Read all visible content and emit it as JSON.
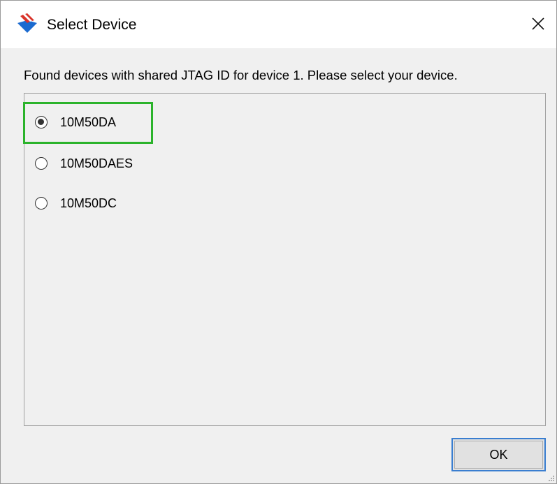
{
  "window": {
    "title": "Select Device",
    "icon": "intel-quartus-logo-icon"
  },
  "dialog": {
    "message": "Found devices with shared JTAG ID for device 1. Please select your device.",
    "devices": [
      {
        "label": "10M50DA",
        "checked": true
      },
      {
        "label": "10M50DAES",
        "checked": false
      },
      {
        "label": "10M50DC",
        "checked": false
      }
    ],
    "ok_label": "OK"
  },
  "colors": {
    "highlight": "#2bb32b",
    "focus_border": "#3a7ed0",
    "logo_blue": "#1c6bd0",
    "logo_red": "#d9342b"
  }
}
